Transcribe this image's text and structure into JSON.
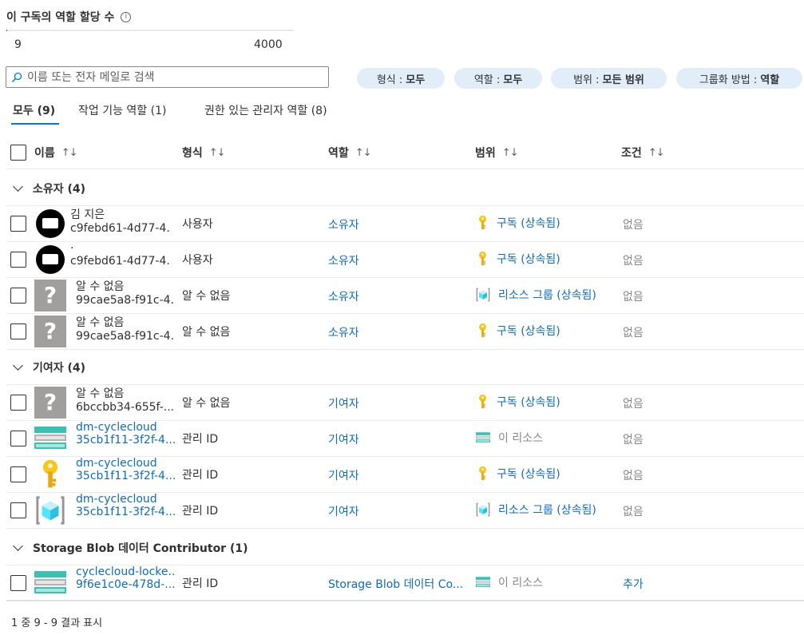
{
  "quota": {
    "title": "이 구독의 역할 할당 수",
    "current": "9",
    "max": "4000",
    "fraction": 0.00225
  },
  "search": {
    "placeholder": "이름 또는 전자 메일로 검색",
    "value": ""
  },
  "filters": [
    {
      "label": "형식 :",
      "value": "모두"
    },
    {
      "label": "역할 :",
      "value": "모두"
    },
    {
      "label": "범위 :",
      "value": "모든 범위"
    },
    {
      "label": "그룹화 방법 :",
      "value": "역할"
    }
  ],
  "tabs": [
    {
      "label": "모두 (9)",
      "active": true
    },
    {
      "label": "작업 기능 역할 (1)",
      "active": false
    },
    {
      "label": "권한 있는 관리자 역할 (8)",
      "active": false
    }
  ],
  "columns": {
    "name": "이름",
    "type": "형식",
    "role": "역할",
    "scope": "범위",
    "condition": "조건",
    "sort": "↑↓"
  },
  "groups": [
    {
      "label": "소유자 (4)",
      "rows": [
        {
          "avatar": "user",
          "line1": "김 지은",
          "line2": "c9febd61-4d77-4...",
          "link": false,
          "type": "사용자",
          "role": "소유자",
          "scope_icon": "key-icon",
          "scope": "구독 (상속됨)",
          "scope_link": true,
          "condition": "없음",
          "condition_link": false
        },
        {
          "avatar": "user",
          "line1": "·",
          "line2": "c9febd61-4d77-4...",
          "link": false,
          "type": "사용자",
          "role": "소유자",
          "scope_icon": "key-icon",
          "scope": "구독 (상속됨)",
          "scope_link": true,
          "condition": "없음",
          "condition_link": false
        },
        {
          "avatar": "unknown",
          "line1": "알 수 없음",
          "line2": "99cae5a8-f91c-4...",
          "link": false,
          "type": "알 수 없음",
          "role": "소유자",
          "scope_icon": "resource-group-icon",
          "scope": "리소스 그룹 (상속됨)",
          "scope_link": true,
          "condition": "없음",
          "condition_link": false
        },
        {
          "avatar": "unknown",
          "line1": "알 수 없음",
          "line2": "99cae5a8-f91c-4...",
          "link": false,
          "type": "알 수 없음",
          "role": "소유자",
          "scope_icon": "key-icon",
          "scope": "구독 (상속됨)",
          "scope_link": true,
          "condition": "없음",
          "condition_link": false
        }
      ]
    },
    {
      "label": "기여자 (4)",
      "rows": [
        {
          "avatar": "unknown",
          "line1": "알 수 없음",
          "line2": "6bccbb34-655f-...",
          "link": false,
          "type": "알 수 없음",
          "role": "기여자",
          "scope_icon": "key-icon",
          "scope": "구독 (상속됨)",
          "scope_link": true,
          "condition": "없음",
          "condition_link": false
        },
        {
          "avatar": "storage",
          "line1": "dm-cyclecloud",
          "line2": "35cb1f11-3f2f-4...",
          "link": true,
          "type": "관리 ID",
          "role": "기여자",
          "scope_icon": "storage-icon",
          "scope": "이 리소스",
          "scope_link": false,
          "condition": "없음",
          "condition_link": false
        },
        {
          "avatar": "key",
          "line1": "dm-cyclecloud",
          "line2": "35cb1f11-3f2f-4...",
          "link": true,
          "type": "관리 ID",
          "role": "기여자",
          "scope_icon": "key-icon",
          "scope": "구독 (상속됨)",
          "scope_link": true,
          "condition": "없음",
          "condition_link": false
        },
        {
          "avatar": "resource-group",
          "line1": "dm-cyclecloud",
          "line2": "35cb1f11-3f2f-4...",
          "link": true,
          "type": "관리 ID",
          "role": "기여자",
          "scope_icon": "resource-group-icon",
          "scope": "리소스 그룹 (상속됨)",
          "scope_link": true,
          "condition": "없음",
          "condition_link": false
        }
      ]
    },
    {
      "label": "Storage Blob 데이터 Contributor (1)",
      "rows": [
        {
          "avatar": "storage",
          "line1": "cyclecloud-locke...",
          "line2": "9f6e1c0e-478d-...",
          "link": true,
          "type": "관리 ID",
          "role": "Storage Blob 데이터 Co...",
          "scope_icon": "storage-icon",
          "scope": "이 리소스",
          "scope_link": false,
          "condition": "추가",
          "condition_link": true
        }
      ]
    }
  ],
  "footer": "1 중 9 - 9 결과 표시",
  "colors": {
    "accent": "#0078d4",
    "link": "#0f6cbd",
    "pill": "#e1eef9",
    "key": "#f8c61b",
    "storage": "#37c2b1"
  }
}
